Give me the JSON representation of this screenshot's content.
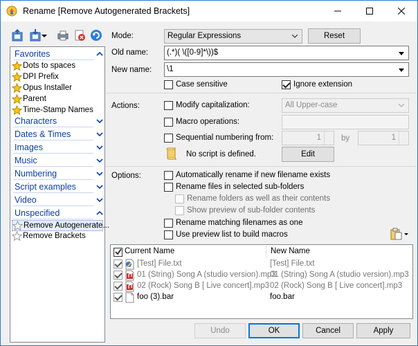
{
  "window": {
    "title": "Rename [Remove Autogenerated Brackets]"
  },
  "sidebar": {
    "favorites": {
      "label": "Favorites",
      "items": [
        "Dots to spaces",
        "DPI Prefix",
        "Opus Installer",
        "Parent",
        "Time-Stamp Names"
      ]
    },
    "categories": [
      "Characters",
      "Dates & Times",
      "Images",
      "Music",
      "Numbering",
      "Script examples",
      "Video"
    ],
    "unspecified": {
      "label": "Unspecified",
      "items": [
        "Remove Autogenerate...",
        "Remove Brackets"
      ]
    }
  },
  "form": {
    "mode_label": "Mode:",
    "mode_value": "Regular Expressions",
    "reset_label": "Reset",
    "old_name_label": "Old name:",
    "old_name_value": "(.*)( \\([0-9]*\\))$",
    "new_name_label": "New name:",
    "new_name_value": "\\1",
    "case_sensitive": "Case sensitive",
    "ignore_extension": "Ignore extension",
    "actions_label": "Actions:",
    "modify_cap": "Modify capitalization:",
    "cap_value": "All Upper-case",
    "macro_ops": "Macro operations:",
    "seq_numbering": "Sequential numbering from:",
    "seq_from": "1",
    "by_label": "by",
    "seq_by": "1",
    "no_script": "No script is defined.",
    "edit_label": "Edit",
    "options_label": "Options:",
    "opt_auto_rename": "Automatically rename if new filename exists",
    "opt_sub_folders": "Rename files in selected sub-folders",
    "opt_folders_contents": "Rename folders as well as their contents",
    "opt_preview_sub": "Show preview of sub-folder contents",
    "opt_matching": "Rename matching filenames as one",
    "opt_preview_list": "Use preview list to build macros"
  },
  "preview": {
    "header_current": "Current Name",
    "header_new": "New Name",
    "rows": [
      {
        "current": "[Test] File.txt",
        "new": "[Test] File.txt",
        "icon": "text-file-icon"
      },
      {
        "current": "01 (String) Song A (studio version).mp3",
        "new": "01 (String) Song A (studio version).mp3",
        "icon": "audio-file-icon"
      },
      {
        "current": "02 (Rock) Song B [ Live concert].mp3",
        "new": "02 (Rock) Song B [ Live concert].mp3",
        "icon": "audio-file-icon"
      },
      {
        "current": "foo (3).bar",
        "new": "foo.bar",
        "icon": "blank-file-icon"
      }
    ]
  },
  "buttons": {
    "undo": "Undo",
    "ok": "OK",
    "cancel": "Cancel",
    "apply": "Apply"
  },
  "colors": {
    "accent": "#0078d7",
    "category_text": "#0b3ea8",
    "window_border": "#2b79d6"
  }
}
